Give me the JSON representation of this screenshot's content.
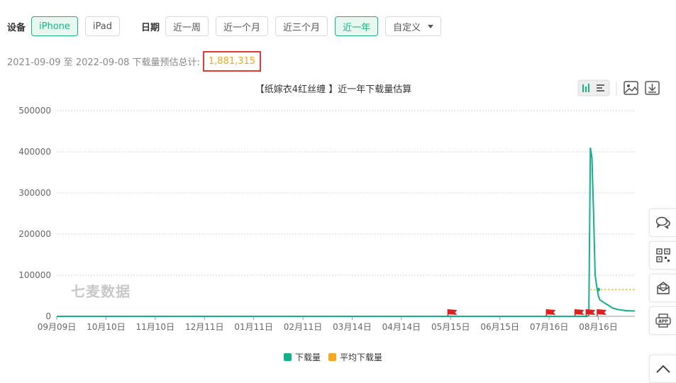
{
  "filters": {
    "device_label": "设备",
    "device_options": [
      "iPhone",
      "iPad"
    ],
    "device_active": "iPhone",
    "date_label": "日期",
    "date_options": [
      "近一周",
      "近一个月",
      "近三个月",
      "近一年"
    ],
    "date_active": "近一年",
    "custom_label": "自定义"
  },
  "summary": {
    "text": "2021-09-09 至 2022-09-08 下载量预估总计:",
    "total": "1,881,315"
  },
  "watermark": "七麦数据",
  "side_tools": [
    "chat-icon",
    "qrcode-icon",
    "mail-icon",
    "app-icon"
  ],
  "colors": {
    "accent": "#18b383",
    "line": "#14b08a",
    "average": "#f5a623",
    "flag": "#e02020",
    "highlight_box": "#e53935"
  },
  "chart_data": {
    "type": "line",
    "title": "【纸嫁衣4红丝缠 】近一年下载量估算",
    "xlabel": "",
    "ylabel": "",
    "ylim": [
      0,
      500000
    ],
    "yticks": [
      0,
      100000,
      200000,
      300000,
      400000,
      500000
    ],
    "xtick_labels": [
      "09月09日",
      "10月10日",
      "11月10日",
      "12月11日",
      "01月11日",
      "02月11日",
      "03月14日",
      "04月14日",
      "05月15日",
      "06月15日",
      "07月16日",
      "08月16日"
    ],
    "xrange": [
      "2021-09-09",
      "2022-09-08"
    ],
    "grid": true,
    "legend_position": "bottom",
    "series": [
      {
        "name": "下载量",
        "color": "#14b08a",
        "points": [
          [
            "2021-09-09",
            0
          ],
          [
            "2022-08-09",
            0
          ],
          [
            "2022-08-10",
            3000
          ],
          [
            "2022-08-11",
            410000
          ],
          [
            "2022-08-12",
            385000
          ],
          [
            "2022-08-13",
            250000
          ],
          [
            "2022-08-14",
            100000
          ],
          [
            "2022-08-15",
            72000
          ],
          [
            "2022-08-16",
            50000
          ],
          [
            "2022-08-17",
            40000
          ],
          [
            "2022-08-19",
            35000
          ],
          [
            "2022-08-21",
            30000
          ],
          [
            "2022-08-23",
            25000
          ],
          [
            "2022-08-25",
            20000
          ],
          [
            "2022-08-27",
            18000
          ],
          [
            "2022-08-29",
            16000
          ],
          [
            "2022-08-31",
            15000
          ],
          [
            "2022-09-02",
            14000
          ],
          [
            "2022-09-05",
            13500
          ],
          [
            "2022-09-08",
            13000
          ]
        ]
      },
      {
        "name": "平均下载量",
        "color": "#f5a623",
        "points": [
          [
            "2022-08-11",
            65000
          ],
          [
            "2022-09-08",
            65000
          ]
        ]
      }
    ],
    "markers": {
      "type": "flag",
      "dates": [
        "2022-05-16",
        "2022-07-17",
        "2022-08-04",
        "2022-08-11",
        "2022-08-18"
      ]
    },
    "average_marker_date": "2022-08-16",
    "average_value": 65000,
    "toolbar_icons": [
      "bar-chart-icon",
      "list-icon",
      "image-icon",
      "download-icon"
    ]
  }
}
